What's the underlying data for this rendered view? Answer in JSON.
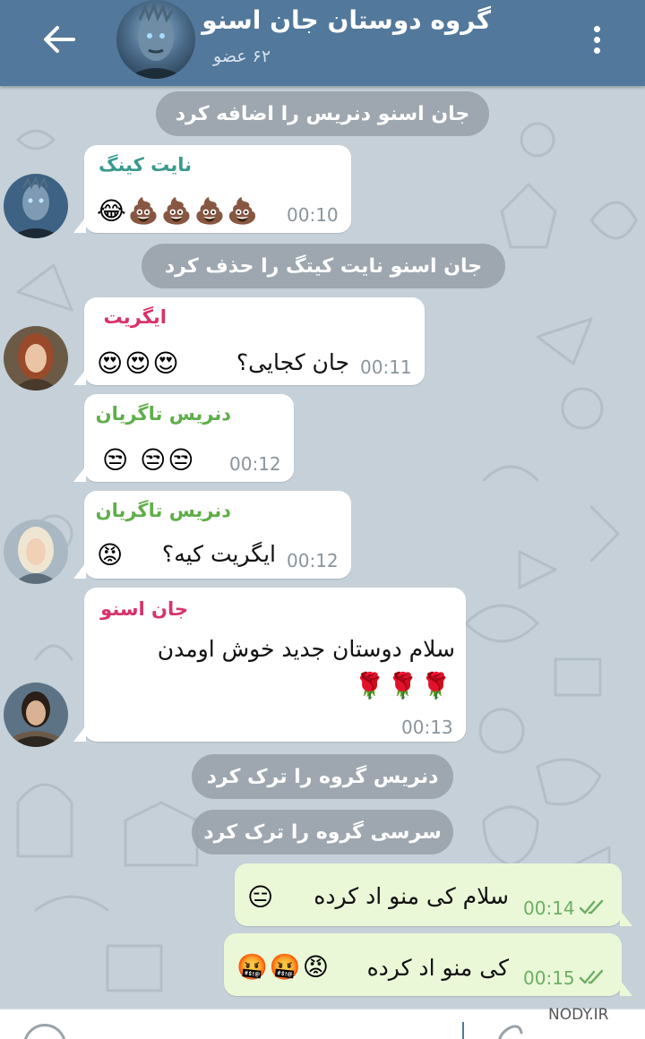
{
  "header": {
    "title": "گروه دوستان جان اسنو",
    "subtitle": "۶۲ عضو",
    "back_icon": "arrow-left-icon",
    "menu_icon": "more-vertical-icon"
  },
  "colors": {
    "header_bg": "#52789b",
    "chat_bg": "#c5d0d8",
    "incoming_bubble": "#ffffff",
    "outgoing_bubble": "#eaf8d8",
    "service_bg": "#969fa8"
  },
  "service_messages": [
    "جان اسنو دنریس را اضافه کرد",
    "جان اسنو نایت کیتگ را حذف کرد",
    "دنریس گروه را ترک کرد",
    "سرسی گروه را ترک کرد"
  ],
  "messages": [
    {
      "sender": "نایت کینگ",
      "sender_color": "#3a9a8e",
      "text": "",
      "emojis": "😂💩💩💩💩",
      "time": "00:10"
    },
    {
      "sender": "ایگریت",
      "sender_color": "#d6336c",
      "text": "جان کجایی؟",
      "emojis": "😍😍😍",
      "time": "00:11"
    },
    {
      "sender": "دنریس تاگریان",
      "sender_color": "#5fae4a",
      "text": "",
      "emojis": "😒 😒😒",
      "time": "00:12"
    },
    {
      "sender": "دنریس تاگریان",
      "sender_color": "#5fae4a",
      "text": "ایگریت کیه؟",
      "emojis": "😡",
      "time": "00:12"
    },
    {
      "sender": "جان اسنو",
      "sender_color": "#d6336c",
      "text": "سلام دوستان جدید خوش اومدن",
      "emojis": "🌹🌹🌹",
      "time": "00:13"
    }
  ],
  "outgoing": [
    {
      "text": "سلام کی منو اد کرده",
      "emojis": "😑",
      "time": "00:14"
    },
    {
      "text": "کی منو اد کرده",
      "emojis": "🤬🤬😡",
      "time": "00:15"
    }
  ],
  "composer": {
    "emoji_icon": "smile-icon",
    "attach_icon": "paperclip-icon"
  },
  "watermark": {
    "text": "NODY.IR"
  }
}
